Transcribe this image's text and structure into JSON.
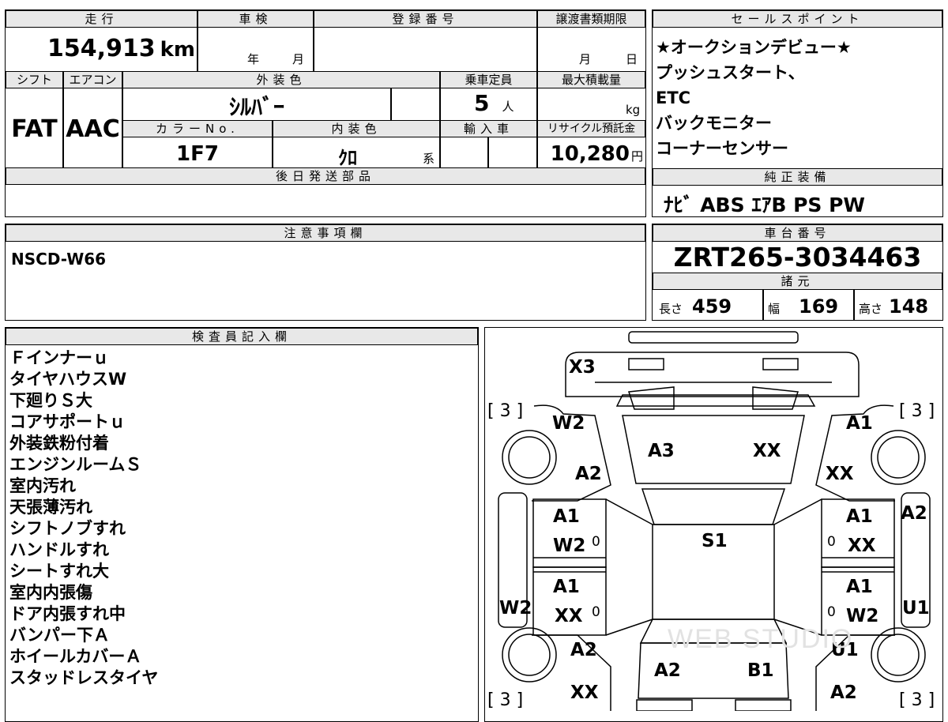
{
  "top_table": {
    "headers": {
      "mileage": "走行",
      "inspection": "車検",
      "registration_number": "登録番号",
      "transfer_deadline": "譲渡書類期限",
      "shift": "シフト",
      "aircon": "エアコン",
      "exterior_color": "外装色",
      "capacity": "乗車定員",
      "max_load": "最大積載量",
      "color_no": "カラーNo.",
      "interior_color": "内装色",
      "import_car": "輸入車",
      "recycle_fee": "リサイクル預託金",
      "later_parts": "後日発送部品"
    },
    "mileage": {
      "value": "154,913",
      "unit": "km"
    },
    "inspection": {
      "year_unit": "年",
      "month_unit": "月"
    },
    "transfer_deadline": {
      "month_unit": "月",
      "day_unit": "日"
    },
    "shift": "FAT",
    "aircon": "AAC",
    "exterior_color": "ｼﾙﾊﾞｰ",
    "capacity": {
      "value": "5",
      "unit": "人"
    },
    "max_load_unit": "kg",
    "color_no": "1F7",
    "interior_color": {
      "value": "ｸﾛ",
      "suffix": "系"
    },
    "recycle_fee": {
      "value": "10,280",
      "unit": "円"
    }
  },
  "sales_points": {
    "header": "セールスポイント",
    "items": [
      "★オークションデビュー★",
      "プッシュスタート、",
      "ETC",
      "バックモニター",
      "コーナーセンサー"
    ]
  },
  "genuine_equipment": {
    "header": "純正装備",
    "value": "ﾅﾋﾞ ABS ｴｱB PS PW"
  },
  "notes": {
    "header": "注意事項欄",
    "value": "NSCD-W66"
  },
  "chassis": {
    "header": "車台番号",
    "value": "ZRT265-3034463"
  },
  "specs": {
    "header": "諸元",
    "length_label": "長さ",
    "length": "459",
    "width_label": "幅",
    "width": "169",
    "height_label": "高さ",
    "height": "148"
  },
  "inspector": {
    "header": "検査員記入欄",
    "items": [
      "Ｆインナーｕ",
      "タイヤハウスW",
      "下廻りＳ大",
      "コアサポートｕ",
      "外装鉄粉付着",
      "エンジンルームＳ",
      "室内汚れ",
      "天張薄汚れ",
      "シフトノブすれ",
      "ハンドルすれ",
      "シートすれ大",
      "室内内張傷",
      "ドア内張すれ中",
      "バンパー下Ａ",
      "ホイールカバーＡ",
      "スタッドレスタイヤ"
    ]
  },
  "diagram": {
    "tire_marks": [
      "[ 3 ]",
      "[ 3 ]",
      "[ 3 ]",
      "[ 3 ]"
    ],
    "codes": {
      "front_bumper": "X3",
      "front_left_fender": "W2",
      "front_right_fender": "A1",
      "left_front_wheel": "A2",
      "right_front_wheel": "XX",
      "hood_left": "A3",
      "hood_right": "XX",
      "left_front_door_1": "A1",
      "left_front_door_2": "W2",
      "right_front_door_1": "A1",
      "right_front_door_2": "XX",
      "roof": "S1",
      "left_rear_door_1": "A1",
      "left_rear_door_2": "XX",
      "right_rear_door_1": "A1",
      "right_rear_door_2": "W2",
      "left_sill": "W2",
      "right_sill_top": "A2",
      "right_sill_bottom": "U1",
      "left_rear_wheel": "A2",
      "right_rear_wheel": "U1",
      "trunk_left": "A2",
      "trunk_right": "B1",
      "rear_left_quarter": "XX",
      "rear_right_quarter": "A2"
    },
    "zero_marks": [
      "0",
      "0",
      "0",
      "0"
    ],
    "watermark": "WEB STUDIO"
  }
}
